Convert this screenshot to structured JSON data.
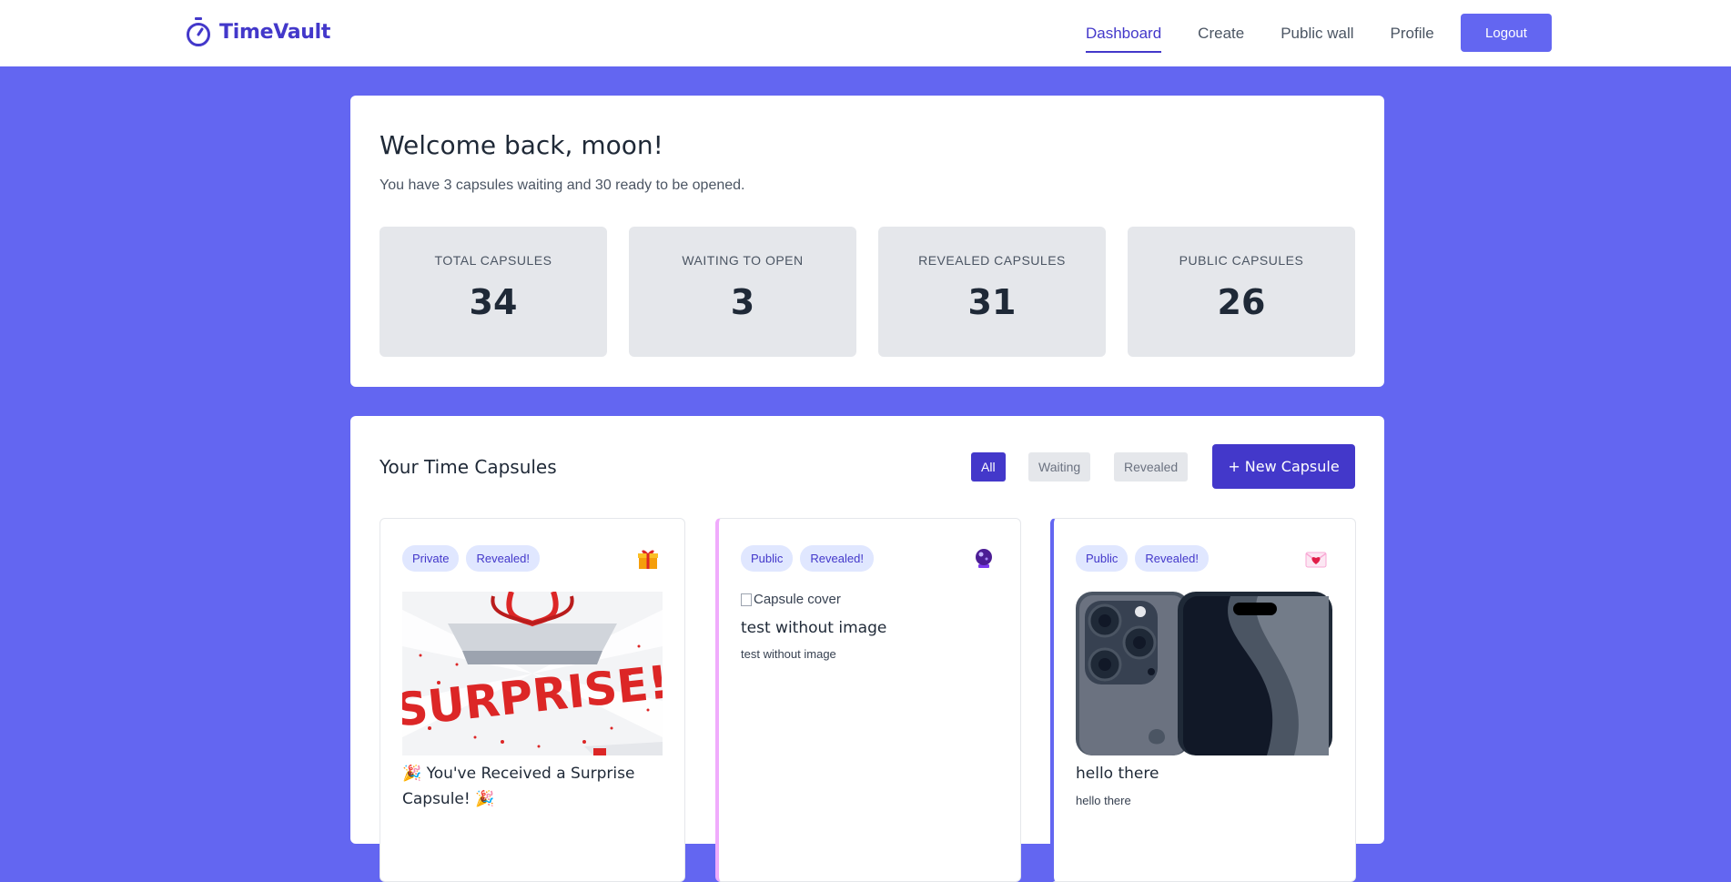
{
  "header": {
    "brand": "TimeVault",
    "nav": [
      "Dashboard",
      "Create",
      "Public wall",
      "Profile"
    ],
    "logout_label": "Logout",
    "colors": {
      "brand": "#4338ca",
      "accent": "#6366f1"
    }
  },
  "welcome": {
    "title": "Welcome back, moon!",
    "subtitle": "You have 3 capsules waiting and 30 ready to be opened.",
    "stats": [
      {
        "label": "TOTAL CAPSULES",
        "value": "34"
      },
      {
        "label": "WAITING TO OPEN",
        "value": "3"
      },
      {
        "label": "REVEALED CAPSULES",
        "value": "31"
      },
      {
        "label": "PUBLIC CAPSULES",
        "value": "26"
      }
    ]
  },
  "capsules": {
    "title": "Your Time Capsules",
    "filters": [
      "All",
      "Waiting",
      "Revealed"
    ],
    "new_button": "+ New Capsule",
    "items": [
      {
        "visibility": "Private",
        "status": "Revealed!",
        "emoji_icon": "gift-icon",
        "image_text": "SURPRISE!",
        "title": "🎉 You've Received a Surprise Capsule! 🎉",
        "text": ""
      },
      {
        "visibility": "Public",
        "status": "Revealed!",
        "emoji_icon": "crystal-ball-icon",
        "image_alt": "Capsule cover",
        "title": "test without image",
        "text": "test without image"
      },
      {
        "visibility": "Public",
        "status": "Revealed!",
        "emoji_icon": "love-letter-icon",
        "title": "hello there",
        "text": "hello there"
      }
    ]
  }
}
